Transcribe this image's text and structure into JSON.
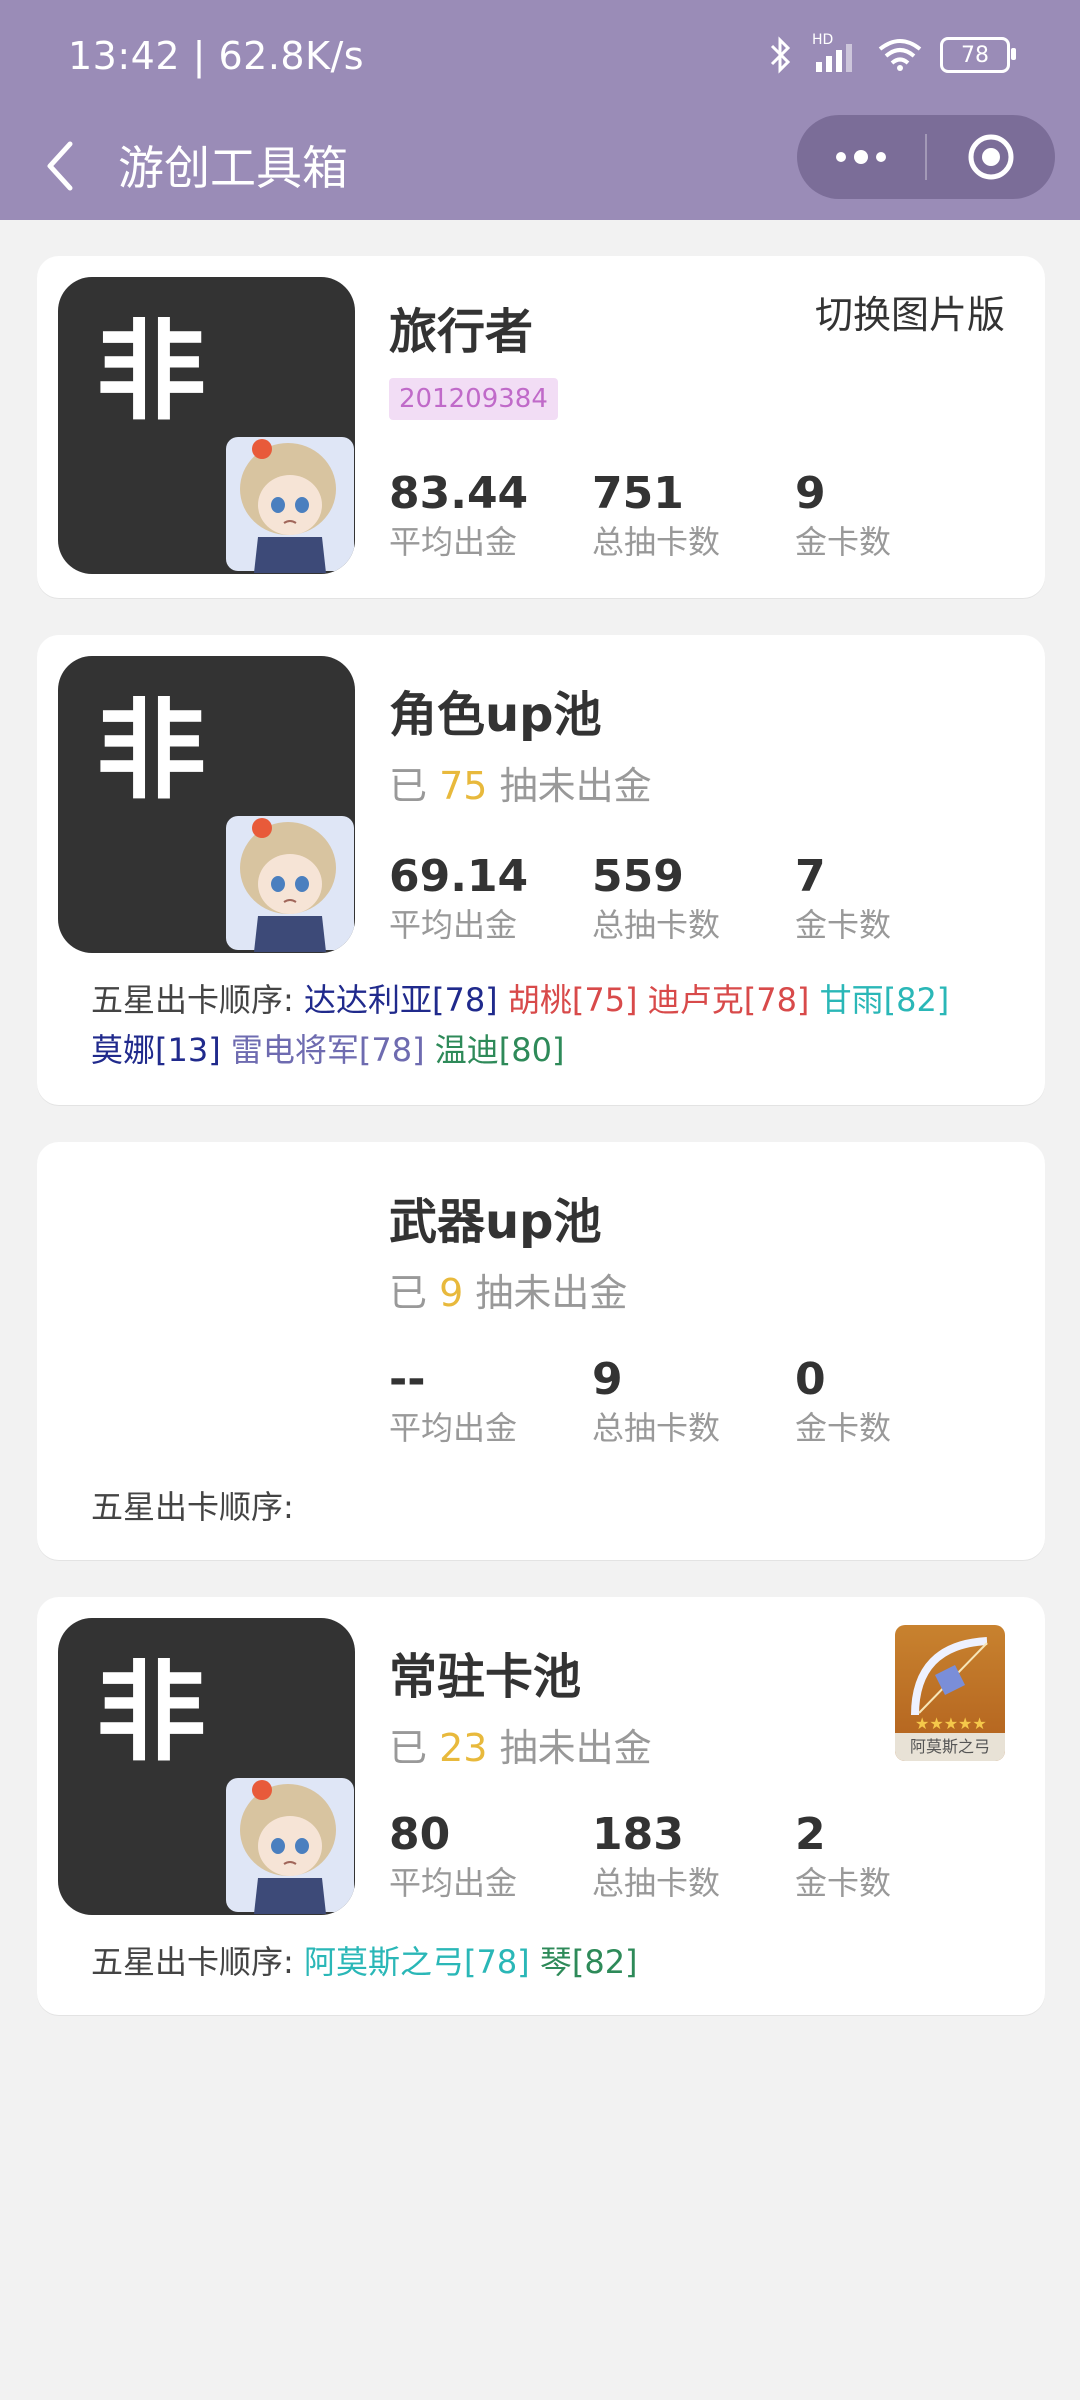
{
  "status_bar": {
    "time": "13:42 | 62.8K/s",
    "battery": "78",
    "network": "HD"
  },
  "nav": {
    "title": "游创工具箱"
  },
  "colors": {
    "header_bg": "#9a8cb7",
    "capsule_bg": "#7b6d98",
    "highlight_number": "#e8b93c",
    "uid_badge_bg": "#f2ddf5",
    "uid_badge_text": "#c06ac9"
  },
  "profile": {
    "avatar_text": "非",
    "name": "旅行者",
    "uid": "201209384",
    "switch_label": "切换图片版",
    "stats": [
      {
        "value": "83.44",
        "label": "平均出金"
      },
      {
        "value": "751",
        "label": "总抽卡数"
      },
      {
        "value": "9",
        "label": "金卡数"
      }
    ]
  },
  "pools": [
    {
      "title": "角色up池",
      "avatar_text": "非",
      "pity_prefix": "已",
      "pity_count": "75",
      "pity_suffix": "抽未出金",
      "stats": [
        {
          "value": "69.14",
          "label": "平均出金"
        },
        {
          "value": "559",
          "label": "总抽卡数"
        },
        {
          "value": "7",
          "label": "金卡数"
        }
      ],
      "order_label": "五星出卡顺序:",
      "order_items": [
        {
          "text": "达达利亚[78]",
          "color": "#202a8c"
        },
        {
          "text": "胡桃[75]",
          "color": "#d84a4a"
        },
        {
          "text": "迪卢克[78]",
          "color": "#d84a4a"
        },
        {
          "text": "甘雨[82]",
          "color": "#2ab7b7"
        },
        {
          "text": "莫娜[13]",
          "color": "#202a8c"
        },
        {
          "text": "雷电将军[78]",
          "color": "#6e6bb0"
        },
        {
          "text": "温迪[80]",
          "color": "#2e8a59"
        }
      ]
    },
    {
      "title": "武器up池",
      "pity_prefix": "已",
      "pity_count": "9",
      "pity_suffix": "抽未出金",
      "stats": [
        {
          "value": "--",
          "label": "平均出金"
        },
        {
          "value": "9",
          "label": "总抽卡数"
        },
        {
          "value": "0",
          "label": "金卡数"
        }
      ],
      "order_label": "五星出卡顺序:"
    },
    {
      "title": "常驻卡池",
      "avatar_text": "非",
      "pity_prefix": "已",
      "pity_count": "23",
      "pity_suffix": "抽未出金",
      "latest_item_caption": "阿莫斯之弓",
      "stats": [
        {
          "value": "80",
          "label": "平均出金"
        },
        {
          "value": "183",
          "label": "总抽卡数"
        },
        {
          "value": "2",
          "label": "金卡数"
        }
      ],
      "order_label": "五星出卡顺序:",
      "order_items": [
        {
          "text": "阿莫斯之弓[78]",
          "color": "#2ab7b7"
        },
        {
          "text": "琴[82]",
          "color": "#2e8a59"
        }
      ]
    }
  ]
}
